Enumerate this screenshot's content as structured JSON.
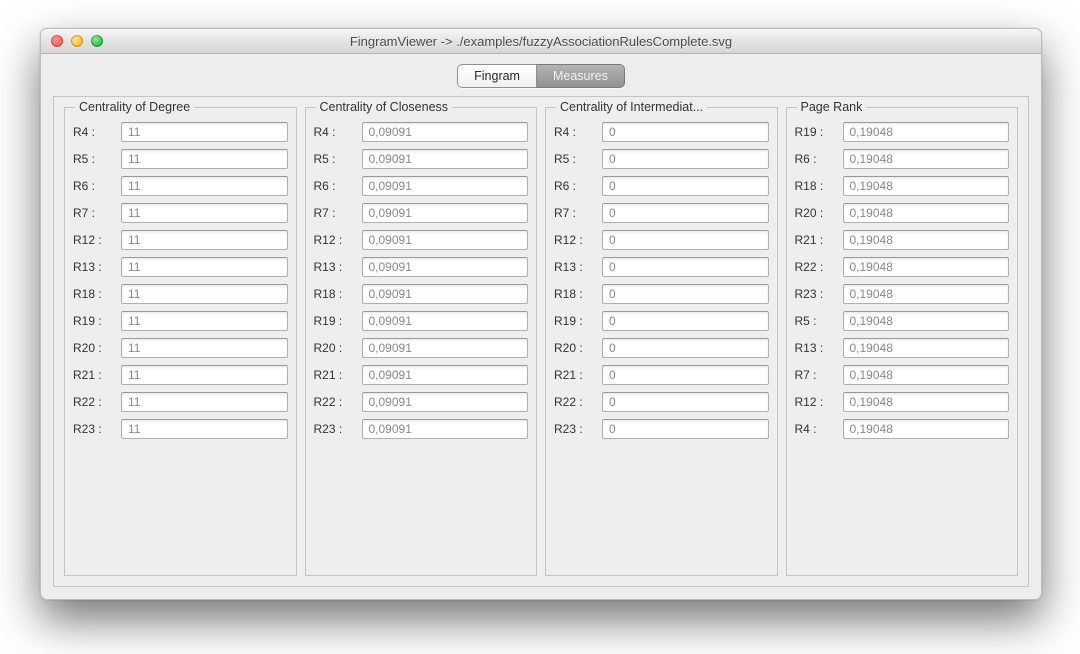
{
  "window": {
    "title": "FingramViewer -> ./examples/fuzzyAssociationRulesComplete.svg"
  },
  "tabs": {
    "left": "Fingram",
    "right": "Measures",
    "selected": "Measures"
  },
  "groups": [
    {
      "title": "Centrality of Degree",
      "rows": [
        {
          "label": "R4 :",
          "value": "11"
        },
        {
          "label": "R5 :",
          "value": "11"
        },
        {
          "label": "R6 :",
          "value": "11"
        },
        {
          "label": "R7 :",
          "value": "11"
        },
        {
          "label": "R12 :",
          "value": "11"
        },
        {
          "label": "R13 :",
          "value": "11"
        },
        {
          "label": "R18 :",
          "value": "11"
        },
        {
          "label": "R19 :",
          "value": "11"
        },
        {
          "label": "R20 :",
          "value": "11"
        },
        {
          "label": "R21 :",
          "value": "11"
        },
        {
          "label": "R22 :",
          "value": "11"
        },
        {
          "label": "R23 :",
          "value": "11"
        }
      ]
    },
    {
      "title": "Centrality of Closeness",
      "rows": [
        {
          "label": "R4 :",
          "value": "0,09091"
        },
        {
          "label": "R5 :",
          "value": "0,09091"
        },
        {
          "label": "R6 :",
          "value": "0,09091"
        },
        {
          "label": "R7 :",
          "value": "0,09091"
        },
        {
          "label": "R12 :",
          "value": "0,09091"
        },
        {
          "label": "R13 :",
          "value": "0,09091"
        },
        {
          "label": "R18 :",
          "value": "0,09091"
        },
        {
          "label": "R19 :",
          "value": "0,09091"
        },
        {
          "label": "R20 :",
          "value": "0,09091"
        },
        {
          "label": "R21 :",
          "value": "0,09091"
        },
        {
          "label": "R22 :",
          "value": "0,09091"
        },
        {
          "label": "R23 :",
          "value": "0,09091"
        }
      ]
    },
    {
      "title": "Centrality of Intermediat...",
      "rows": [
        {
          "label": "R4 :",
          "value": "0"
        },
        {
          "label": "R5 :",
          "value": "0"
        },
        {
          "label": "R6 :",
          "value": "0"
        },
        {
          "label": "R7 :",
          "value": "0"
        },
        {
          "label": "R12 :",
          "value": "0"
        },
        {
          "label": "R13 :",
          "value": "0"
        },
        {
          "label": "R18 :",
          "value": "0"
        },
        {
          "label": "R19 :",
          "value": "0"
        },
        {
          "label": "R20 :",
          "value": "0"
        },
        {
          "label": "R21 :",
          "value": "0"
        },
        {
          "label": "R22 :",
          "value": "0"
        },
        {
          "label": "R23 :",
          "value": "0"
        }
      ]
    },
    {
      "title": "Page Rank",
      "rows": [
        {
          "label": "R19 :",
          "value": "0,19048"
        },
        {
          "label": "R6 :",
          "value": "0,19048"
        },
        {
          "label": "R18 :",
          "value": "0,19048"
        },
        {
          "label": "R20 :",
          "value": "0,19048"
        },
        {
          "label": "R21 :",
          "value": "0,19048"
        },
        {
          "label": "R22 :",
          "value": "0,19048"
        },
        {
          "label": "R23 :",
          "value": "0,19048"
        },
        {
          "label": "R5 :",
          "value": "0,19048"
        },
        {
          "label": "R13 :",
          "value": "0,19048"
        },
        {
          "label": "R7 :",
          "value": "0,19048"
        },
        {
          "label": "R12 :",
          "value": "0,19048"
        },
        {
          "label": "R4 :",
          "value": "0,19048"
        }
      ]
    }
  ]
}
